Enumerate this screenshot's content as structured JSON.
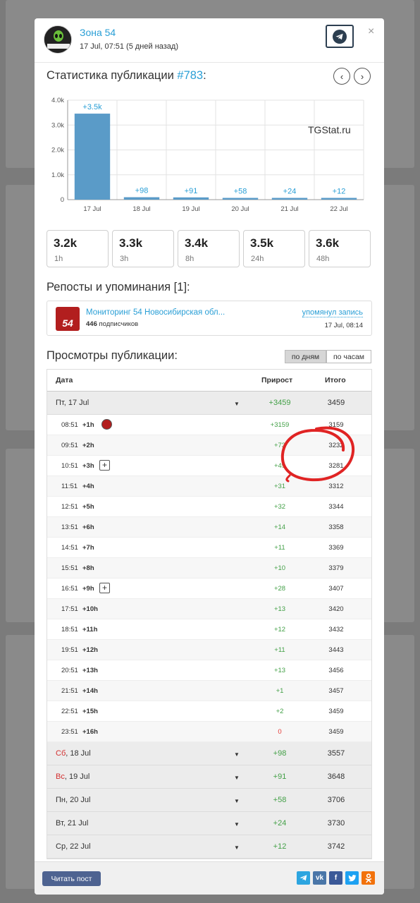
{
  "channel": {
    "name": "Зона 54",
    "date": "17 Jul, 07:51 (5 дней назад)",
    "avatar_text": "ЗОНА 54"
  },
  "stats_section": {
    "title_prefix": "Статистика публикации ",
    "post_number": "#783",
    "title_suffix": ":"
  },
  "chart_data": {
    "type": "bar",
    "watermark": "TGStat.ru",
    "categories": [
      "17 Jul",
      "18 Jul",
      "19 Jul",
      "20 Jul",
      "21 Jul",
      "22 Jul"
    ],
    "values": [
      3459,
      98,
      91,
      58,
      24,
      12
    ],
    "data_labels": [
      "+3.5k",
      "+98",
      "+91",
      "+58",
      "+24",
      "+12"
    ],
    "y_ticks": [
      "0",
      "1.0k",
      "2.0k",
      "3.0k",
      "4.0k"
    ],
    "y_tick_values": [
      0,
      1000,
      2000,
      3000,
      4000
    ],
    "ylim": [
      0,
      4000
    ],
    "color": "#5a9bc8",
    "grid": true
  },
  "stat_boxes": [
    {
      "value": "3.2k",
      "label": "1h"
    },
    {
      "value": "3.3k",
      "label": "3h"
    },
    {
      "value": "3.4k",
      "label": "8h"
    },
    {
      "value": "3.5k",
      "label": "24h"
    },
    {
      "value": "3.6k",
      "label": "48h"
    }
  ],
  "reposts": {
    "title": "Репосты и упоминания [1]:",
    "item": {
      "icon_text": "54",
      "name": "Мониторинг 54 Новосибирская обл...",
      "subs_count": "446",
      "subs_label": " подписчиков",
      "action": "упомянул запись",
      "date": "17 Jul, 08:14"
    }
  },
  "views": {
    "title": "Просмотры публикации:",
    "toggle_days": "по дням",
    "toggle_hours": "по часам",
    "col_date": "Дата",
    "col_growth": "Прирост",
    "col_total": "Итого",
    "first_day": {
      "weekday": "Пт",
      "date": ", 17 Jul",
      "growth": "+3459",
      "total": "3459"
    },
    "hours": [
      {
        "time": "08:51",
        "offset": "+1h",
        "growth": "+3159",
        "total": "3159"
      },
      {
        "time": "09:51",
        "offset": "+2h",
        "growth": "+73",
        "total": "3232"
      },
      {
        "time": "10:51",
        "offset": "+3h",
        "growth": "+49",
        "total": "3281"
      },
      {
        "time": "11:51",
        "offset": "+4h",
        "growth": "+31",
        "total": "3312"
      },
      {
        "time": "12:51",
        "offset": "+5h",
        "growth": "+32",
        "total": "3344"
      },
      {
        "time": "13:51",
        "offset": "+6h",
        "growth": "+14",
        "total": "3358"
      },
      {
        "time": "14:51",
        "offset": "+7h",
        "growth": "+11",
        "total": "3369"
      },
      {
        "time": "15:51",
        "offset": "+8h",
        "growth": "+10",
        "total": "3379"
      },
      {
        "time": "16:51",
        "offset": "+9h",
        "growth": "+28",
        "total": "3407"
      },
      {
        "time": "17:51",
        "offset": "+10h",
        "growth": "+13",
        "total": "3420"
      },
      {
        "time": "18:51",
        "offset": "+11h",
        "growth": "+12",
        "total": "3432"
      },
      {
        "time": "19:51",
        "offset": "+12h",
        "growth": "+11",
        "total": "3443"
      },
      {
        "time": "20:51",
        "offset": "+13h",
        "growth": "+13",
        "total": "3456"
      },
      {
        "time": "21:51",
        "offset": "+14h",
        "growth": "+1",
        "total": "3457"
      },
      {
        "time": "22:51",
        "offset": "+15h",
        "growth": "+2",
        "total": "3459"
      },
      {
        "time": "23:51",
        "offset": "+16h",
        "growth": "0",
        "total": "3459"
      }
    ],
    "days": [
      {
        "weekday": "Сб",
        "date": ", 18 Jul",
        "growth": "+98",
        "total": "3557"
      },
      {
        "weekday": "Вс",
        "date": ", 19 Jul",
        "growth": "+91",
        "total": "3648"
      },
      {
        "weekday": "Пн",
        "date": ", 20 Jul",
        "growth": "+58",
        "total": "3706"
      },
      {
        "weekday": "Вт",
        "date": ", 21 Jul",
        "growth": "+24",
        "total": "3730"
      },
      {
        "weekday": "Ср",
        "date": ", 22 Jul",
        "growth": "+12",
        "total": "3742"
      }
    ]
  },
  "footer": {
    "read_button": "Читать пост",
    "share_icons": [
      "telegram-icon",
      "vk-icon",
      "facebook-icon",
      "twitter-icon",
      "odnoklassniki-icon"
    ]
  },
  "colors": {
    "link": "#2a9fd6",
    "positive": "#43a047",
    "negative": "#e53935",
    "weekend": "#d32f2f",
    "annotation": "#e02424"
  }
}
